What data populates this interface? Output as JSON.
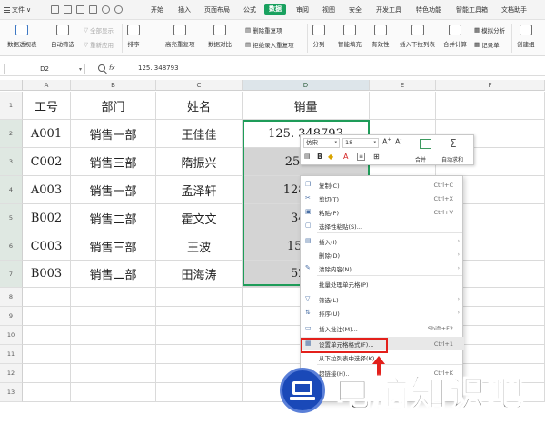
{
  "menubar": {
    "file_label": "文件",
    "tabs": [
      "开始",
      "插入",
      "页面布局",
      "公式",
      "数据",
      "审阅",
      "视图",
      "安全",
      "开发工具",
      "特色功能",
      "智能工具箱",
      "文档助手"
    ],
    "active_tab": "数据"
  },
  "ribbon": {
    "pivot_table": "数据透视表",
    "auto_filter": "自动筛选",
    "show_all": "全部显示",
    "reapply": "重新应用",
    "sort": "排序",
    "highlight_dup": "高亮重复项",
    "data_compare": "数据对比",
    "delete_dup": "删除重复项",
    "reject_dup": "拒绝录入重复项",
    "split": "分列",
    "smart_fill": "智能填充",
    "validity": "有效性",
    "insert_dropdown": "插入下拉列表",
    "merge_calc": "合并计算",
    "simulate": "模拟分析",
    "record_sheet": "记录单",
    "create_group": "创建组"
  },
  "formula_bar": {
    "name_box": "D2",
    "fx": "fx",
    "value": "125. 348793"
  },
  "columns": [
    "A",
    "B",
    "C",
    "D",
    "E",
    "F"
  ],
  "rows": [
    "1",
    "2",
    "3",
    "4",
    "5",
    "6",
    "7",
    "8",
    "9",
    "10",
    "11",
    "12",
    "13"
  ],
  "table": {
    "headers": [
      "工号",
      "部门",
      "姓名",
      "销量"
    ],
    "rows": [
      [
        "A001",
        "销售一部",
        "王佳佳",
        "125. 348793"
      ],
      [
        "C002",
        "销售三部",
        "隋振兴",
        "2545.2"
      ],
      [
        "A003",
        "销售一部",
        "孟泽轩",
        "128. 23"
      ],
      [
        "B002",
        "销售二部",
        "霍文文",
        "34. 7"
      ],
      [
        "C003",
        "销售三部",
        "王波",
        "155. 6"
      ],
      [
        "B003",
        "销售二部",
        "田海涛",
        "5228"
      ]
    ]
  },
  "mini_toolbar": {
    "font": "仿宋",
    "size": "18",
    "bold": "B",
    "merge": "合并",
    "autosum": "自动求和"
  },
  "context_menu": {
    "items": [
      {
        "label": "复制(C)",
        "key": "Ctrl+C"
      },
      {
        "label": "剪切(T)",
        "key": "Ctrl+X"
      },
      {
        "label": "粘贴(P)",
        "key": "Ctrl+V"
      },
      {
        "label": "选择性粘贴(S)...",
        "key": ""
      },
      {
        "label": "插入(I)",
        "key": ""
      },
      {
        "label": "删除(D)",
        "key": ""
      },
      {
        "label": "清除内容(N)",
        "key": ""
      },
      {
        "label": "批量处理单元格(P)",
        "key": ""
      },
      {
        "label": "筛选(L)",
        "key": ""
      },
      {
        "label": "排序(U)",
        "key": ""
      },
      {
        "label": "插入批注(M)...",
        "key": "Shift+F2"
      },
      {
        "label": "设置单元格格式(F)...",
        "key": "Ctrl+1"
      },
      {
        "label": "从下拉列表中选择(K)...",
        "key": ""
      },
      {
        "label": "超链接(H)...",
        "key": "Ctrl+K"
      }
    ]
  },
  "watermark": {
    "text": "电脑知识吧"
  },
  "colors": {
    "accent_green": "#19a15f",
    "selection_border": "#1e9c59",
    "highlight_red": "#e3201b",
    "watermark_blue": "#1a49b8"
  }
}
